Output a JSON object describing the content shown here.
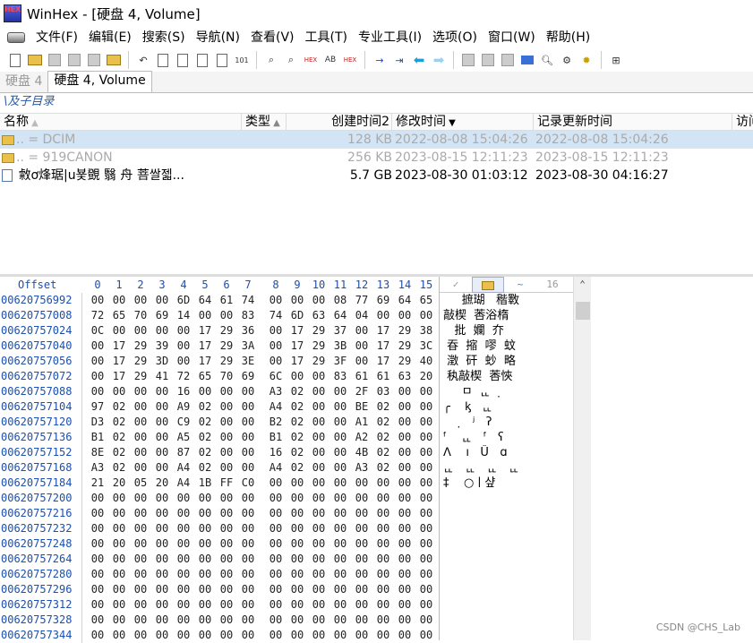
{
  "window": {
    "title": "WinHex - [硬盘 4, Volume]",
    "icon_label": "HEX"
  },
  "menu": [
    "文件(F)",
    "编辑(E)",
    "搜索(S)",
    "导航(N)",
    "查看(V)",
    "工具(T)",
    "专业工具(I)",
    "选项(O)",
    "窗口(W)",
    "帮助(H)"
  ],
  "toolbar": {
    "icons": [
      "new-icon",
      "open-icon",
      "save-icon",
      "print-icon",
      "properties-icon",
      "open-folder-icon",
      "undo-icon",
      "copy-icon",
      "cut-icon",
      "paste-icon",
      "paste-special-icon",
      "write-binary-icon",
      "find-icon",
      "replace-icon",
      "find-hex-icon",
      "find-text-icon",
      "replace-hex-icon",
      "goto-offset-icon",
      "goto-sector-icon",
      "back-icon",
      "forward-icon",
      "open-disk-icon",
      "clone-disk-icon",
      "disk-tools-icon",
      "calculator-icon",
      "search-icon",
      "settings-icon",
      "wizard-icon",
      "layout-icon"
    ],
    "hex_label": "HEX"
  },
  "tabs": [
    {
      "label": "硬盘 4"
    },
    {
      "label": "硬盘 4, Volume"
    }
  ],
  "path": "\\及子目录",
  "columns": {
    "name": "名称",
    "type": "类型",
    "created": "创建时间2",
    "modified": "修改时间",
    "record_updated": "记录更新时间",
    "access": "访问"
  },
  "files": [
    {
      "name": "..  =  DCIM",
      "size": "128 KB",
      "modified": "2022-08-08  15:04:26",
      "record_updated": "2022-08-08  15:04:26",
      "kind": "folder",
      "selected": true,
      "dim": true
    },
    {
      "name": "..  =  919CANON",
      "size": "256 KB",
      "modified": "2023-08-15  12:11:23",
      "record_updated": "2023-08-15  12:11:23",
      "kind": "folder",
      "selected": false,
      "dim": true
    },
    {
      "name": " 敹ơ烽琚|u뵻覴 翳    舟  菩쌀젧...",
      "size": "5.7 GB",
      "modified": "2023-08-30  01:03:12",
      "record_updated": "2023-08-30  04:16:27",
      "kind": "file",
      "selected": false,
      "dim": false
    }
  ],
  "hex": {
    "offset_title": "Offset",
    "column_headers": [
      "0",
      "1",
      "2",
      "3",
      "4",
      "5",
      "6",
      "7",
      "8",
      "9",
      "10",
      "11",
      "12",
      "13",
      "14",
      "15"
    ],
    "rows": [
      {
        "offset": "00620756992",
        "bytes": [
          "00",
          "00",
          "00",
          "00",
          "6D",
          "64",
          "61",
          "74",
          "00",
          "00",
          "00",
          "08",
          "77",
          "69",
          "64",
          "65"
        ]
      },
      {
        "offset": "00620757008",
        "bytes": [
          "72",
          "65",
          "70",
          "69",
          "14",
          "00",
          "00",
          "83",
          "74",
          "6D",
          "63",
          "64",
          "04",
          "00",
          "00",
          "00"
        ]
      },
      {
        "offset": "00620757024",
        "bytes": [
          "0C",
          "00",
          "00",
          "00",
          "00",
          "17",
          "29",
          "36",
          "00",
          "17",
          "29",
          "37",
          "00",
          "17",
          "29",
          "38"
        ]
      },
      {
        "offset": "00620757040",
        "bytes": [
          "00",
          "17",
          "29",
          "39",
          "00",
          "17",
          "29",
          "3A",
          "00",
          "17",
          "29",
          "3B",
          "00",
          "17",
          "29",
          "3C"
        ]
      },
      {
        "offset": "00620757056",
        "bytes": [
          "00",
          "17",
          "29",
          "3D",
          "00",
          "17",
          "29",
          "3E",
          "00",
          "17",
          "29",
          "3F",
          "00",
          "17",
          "29",
          "40"
        ]
      },
      {
        "offset": "00620757072",
        "bytes": [
          "00",
          "17",
          "29",
          "41",
          "72",
          "65",
          "70",
          "69",
          "6C",
          "00",
          "00",
          "83",
          "61",
          "61",
          "63",
          "20"
        ]
      },
      {
        "offset": "00620757088",
        "bytes": [
          "00",
          "00",
          "00",
          "00",
          "16",
          "00",
          "00",
          "00",
          "A3",
          "02",
          "00",
          "00",
          "2F",
          "03",
          "00",
          "00"
        ]
      },
      {
        "offset": "00620757104",
        "bytes": [
          "97",
          "02",
          "00",
          "00",
          "A9",
          "02",
          "00",
          "00",
          "A4",
          "02",
          "00",
          "00",
          "BE",
          "02",
          "00",
          "00"
        ]
      },
      {
        "offset": "00620757120",
        "bytes": [
          "D3",
          "02",
          "00",
          "00",
          "C9",
          "02",
          "00",
          "00",
          "B2",
          "02",
          "00",
          "00",
          "A1",
          "02",
          "00",
          "00"
        ]
      },
      {
        "offset": "00620757136",
        "bytes": [
          "B1",
          "02",
          "00",
          "00",
          "A5",
          "02",
          "00",
          "00",
          "B1",
          "02",
          "00",
          "00",
          "A2",
          "02",
          "00",
          "00"
        ]
      },
      {
        "offset": "00620757152",
        "bytes": [
          "8E",
          "02",
          "00",
          "00",
          "87",
          "02",
          "00",
          "00",
          "16",
          "02",
          "00",
          "00",
          "4B",
          "02",
          "00",
          "00"
        ]
      },
      {
        "offset": "00620757168",
        "bytes": [
          "A3",
          "02",
          "00",
          "00",
          "A4",
          "02",
          "00",
          "00",
          "A4",
          "02",
          "00",
          "00",
          "A3",
          "02",
          "00",
          "00"
        ]
      },
      {
        "offset": "00620757184",
        "bytes": [
          "21",
          "20",
          "05",
          "20",
          "A4",
          "1B",
          "FF",
          "C0",
          "00",
          "00",
          "00",
          "00",
          "00",
          "00",
          "00",
          "00"
        ]
      },
      {
        "offset": "00620757200",
        "bytes": [
          "00",
          "00",
          "00",
          "00",
          "00",
          "00",
          "00",
          "00",
          "00",
          "00",
          "00",
          "00",
          "00",
          "00",
          "00",
          "00"
        ]
      },
      {
        "offset": "00620757216",
        "bytes": [
          "00",
          "00",
          "00",
          "00",
          "00",
          "00",
          "00",
          "00",
          "00",
          "00",
          "00",
          "00",
          "00",
          "00",
          "00",
          "00"
        ]
      },
      {
        "offset": "00620757232",
        "bytes": [
          "00",
          "00",
          "00",
          "00",
          "00",
          "00",
          "00",
          "00",
          "00",
          "00",
          "00",
          "00",
          "00",
          "00",
          "00",
          "00"
        ]
      },
      {
        "offset": "00620757248",
        "bytes": [
          "00",
          "00",
          "00",
          "00",
          "00",
          "00",
          "00",
          "00",
          "00",
          "00",
          "00",
          "00",
          "00",
          "00",
          "00",
          "00"
        ]
      },
      {
        "offset": "00620757264",
        "bytes": [
          "00",
          "00",
          "00",
          "00",
          "00",
          "00",
          "00",
          "00",
          "00",
          "00",
          "00",
          "00",
          "00",
          "00",
          "00",
          "00"
        ]
      },
      {
        "offset": "00620757280",
        "bytes": [
          "00",
          "00",
          "00",
          "00",
          "00",
          "00",
          "00",
          "00",
          "00",
          "00",
          "00",
          "00",
          "00",
          "00",
          "00",
          "00"
        ]
      },
      {
        "offset": "00620757296",
        "bytes": [
          "00",
          "00",
          "00",
          "00",
          "00",
          "00",
          "00",
          "00",
          "00",
          "00",
          "00",
          "00",
          "00",
          "00",
          "00",
          "00"
        ]
      },
      {
        "offset": "00620757312",
        "bytes": [
          "00",
          "00",
          "00",
          "00",
          "00",
          "00",
          "00",
          "00",
          "00",
          "00",
          "00",
          "00",
          "00",
          "00",
          "00",
          "00"
        ]
      },
      {
        "offset": "00620757328",
        "bytes": [
          "00",
          "00",
          "00",
          "00",
          "00",
          "00",
          "00",
          "00",
          "00",
          "00",
          "00",
          "00",
          "00",
          "00",
          "00",
          "00"
        ]
      },
      {
        "offset": "00620757344",
        "bytes": [
          "00",
          "00",
          "00",
          "00",
          "00",
          "00",
          "00",
          "00",
          "00",
          "00",
          "00",
          "00",
          "00",
          "00",
          "00",
          "00"
        ]
      }
    ]
  },
  "text_panel": {
    "tab_label": "16",
    "lines": [
      "     摭瑚   稭斁",
      "敲楔  莕浴楕",
      "   批  孄  夰",
      " 昋  摍  嘐  蚊",
      " 澂  矸  䖢  略",
      " 秇敲楔  莕悏",
      "     ㅁ  ᇿ   ̣",
      "╭    ᶄ   ᇿ",
      "     ̣   ʲ   ʔ",
      "ᶠ    ᇿ   ᶠ   ʕ",
      "ᐱ    ı   Û   ɑ",
      "ᇿ   ᇿ   ᇿ   ᇿ",
      "‡    ○ㅣ샾"
    ]
  },
  "watermark": "CSDN @CHS_Lab"
}
